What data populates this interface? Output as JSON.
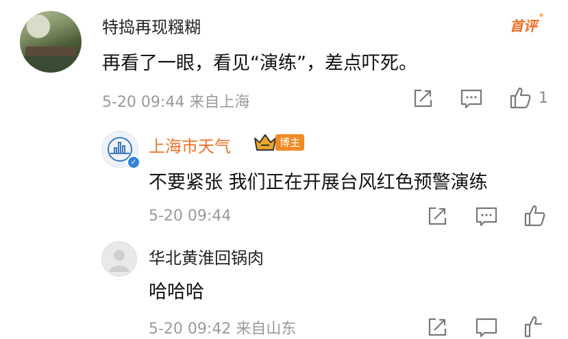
{
  "comments": [
    {
      "username": "特捣再现糨糊",
      "badge": "首评",
      "text": "再看了一眼，看见“演练”，差点吓死。",
      "meta": "5-20 09:44  来自上海",
      "like_count": "1",
      "icons": [
        "share-icon",
        "comment-icon",
        "like-icon"
      ]
    },
    {
      "username": "上海市天气",
      "tag": "博主",
      "text": "不要紧张 我们正在开展台风红色预警演练",
      "meta": "5-20 09:44",
      "icons": [
        "share-icon",
        "comment-icon",
        "like-icon"
      ]
    },
    {
      "username": "华北黄淮回锅肉",
      "text": "哈哈哈",
      "meta": "5-20 09:42  来自山东",
      "icons": [
        "share-icon",
        "comment-icon",
        "like-icon"
      ]
    }
  ],
  "colors": {
    "accent_orange": "#f1722a",
    "verified_blue": "#2f84d8",
    "meta_gray": "#9a9a9a"
  }
}
